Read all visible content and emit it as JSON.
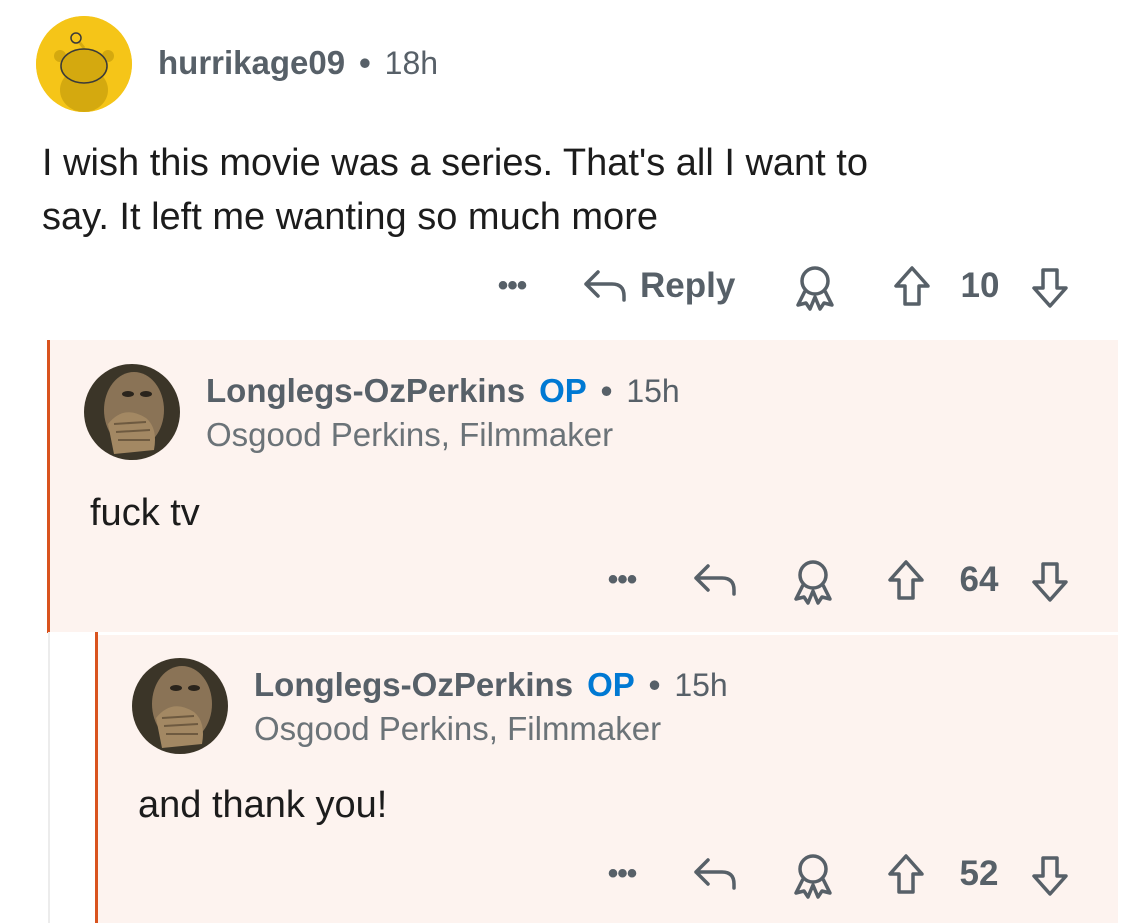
{
  "comments": [
    {
      "username": "hurrikage09",
      "time": "18h",
      "body_lines": [
        "I wish this movie was a series. That's all I want to",
        "say. It left me wanting so much more"
      ],
      "actions": {
        "more": "•••",
        "reply_label": "Reply",
        "score": "10"
      }
    },
    {
      "username": "Longlegs-OzPerkins",
      "op_badge": "OP",
      "time": "15h",
      "flair": "Osgood Perkins, Filmmaker",
      "body": "fuck tv",
      "actions": {
        "more": "•••",
        "score": "64"
      }
    },
    {
      "username": "Longlegs-OzPerkins",
      "op_badge": "OP",
      "time": "15h",
      "flair": "Osgood Perkins, Filmmaker",
      "body": "and thank you!",
      "actions": {
        "more": "•••",
        "score": "52"
      }
    }
  ],
  "colors": {
    "highlight_bg": "#fdf3ef",
    "thread_line": "#d9531e",
    "op_badge": "#0079d3",
    "meta_text": "#576068",
    "snoo_avatar_bg": "#f5c518"
  },
  "icons": {
    "snoo": "snoo-avatar-icon",
    "reply": "reply-arrow-icon",
    "award": "award-icon",
    "upvote": "upvote-arrow-icon",
    "downvote": "downvote-arrow-icon",
    "more": "more-dots-icon"
  }
}
